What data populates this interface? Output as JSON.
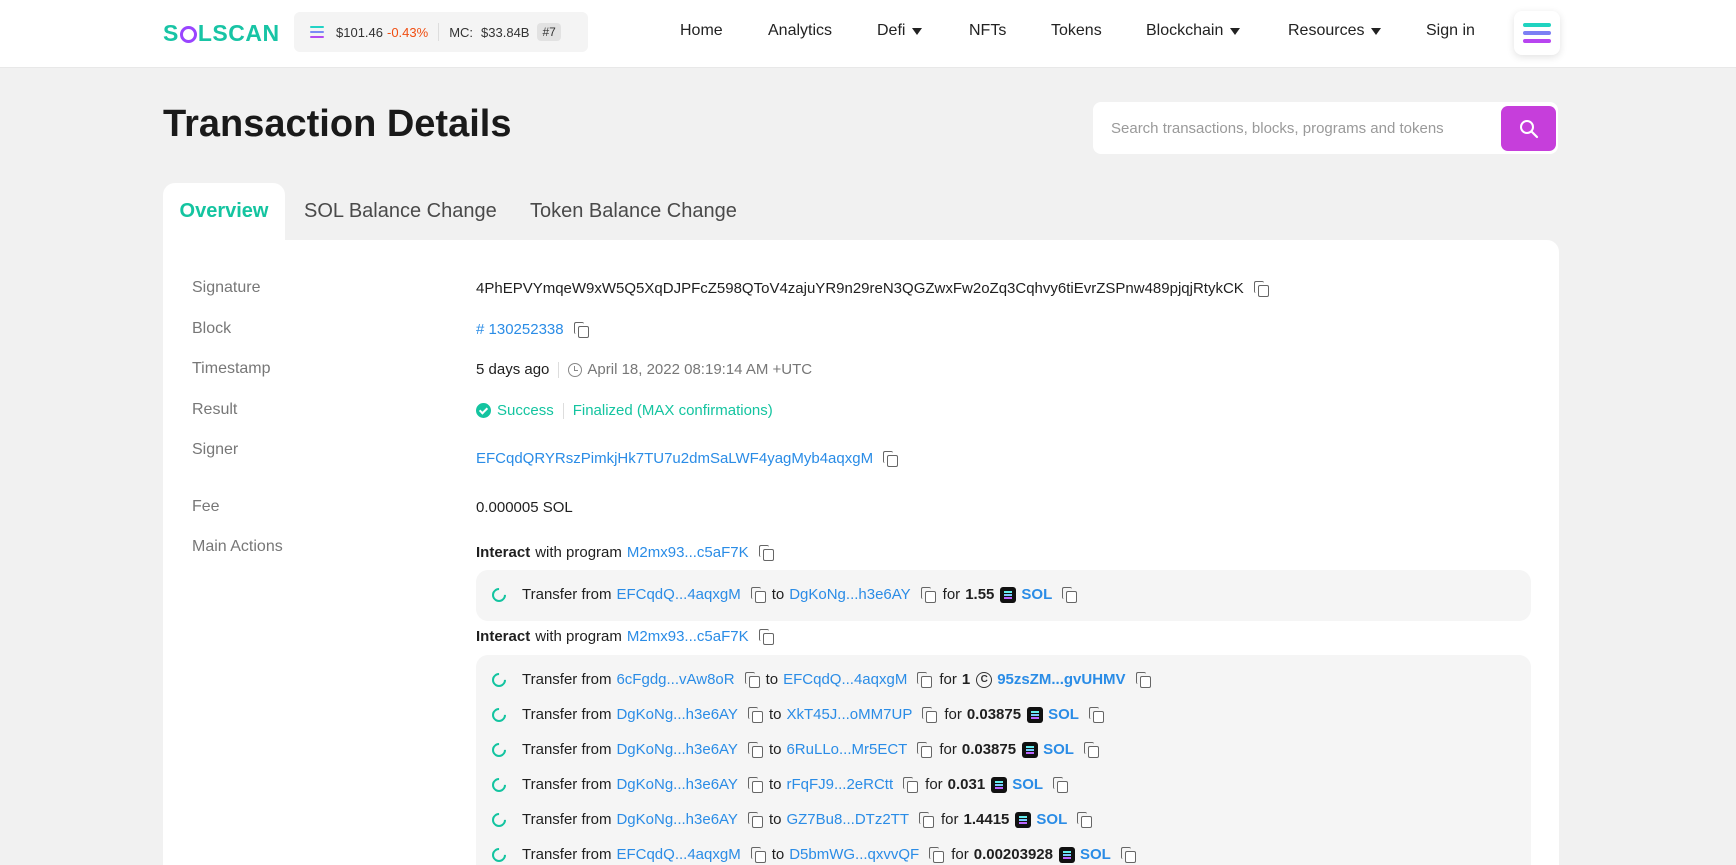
{
  "header": {
    "logo": {
      "pre": "S",
      "post": "LSCAN"
    },
    "price": "$101.46",
    "change": "-0.43%",
    "mc_label": "MC:",
    "mc_value": "$33.84B",
    "rank": "#7",
    "nav": {
      "home": "Home",
      "analytics": "Analytics",
      "defi": "Defi",
      "nfts": "NFTs",
      "tokens": "Tokens",
      "blockchain": "Blockchain",
      "resources": "Resources",
      "signin": "Sign in"
    },
    "colors": {
      "accent": "#14c4a0",
      "brand_purple": "#9945ff",
      "search_button": "#c63edb",
      "negative": "#f04e12",
      "link": "#2a8ce6"
    }
  },
  "page": {
    "title": "Transaction Details",
    "search_placeholder": "Search transactions, blocks, programs and tokens"
  },
  "tabs": {
    "overview": "Overview",
    "sol_balance": "SOL Balance Change",
    "token_balance": "Token Balance Change"
  },
  "details": {
    "signature_label": "Signature",
    "signature": "4PhEPVYmqeW9xW5Q5XqDJPFcZ598QToV4zajuYR9n29reN3QGZwxFw2oZq3Cqhvy6tiEvrZSPnw489pjqjRtykCK",
    "block_label": "Block",
    "block": "# 130252338",
    "timestamp_label": "Timestamp",
    "time_ago": "5 days ago",
    "time_full": "April 18, 2022 08:19:14 AM +UTC",
    "result_label": "Result",
    "result": "Success",
    "finalized": "Finalized (MAX confirmations)",
    "signer_label": "Signer",
    "signer": "EFCqdQRYRszPimkjHk7TU7u2dmSaLWF4yagMyb4aqxgM",
    "fee_label": "Fee",
    "fee": "0.000005 SOL",
    "main_actions_label": "Main Actions"
  },
  "actions": {
    "interact_word": "Interact",
    "with_program": "with program",
    "transfer_from": "Transfer from",
    "to": "to",
    "for": "for",
    "group1": {
      "program": "M2mx93...c5aF7K",
      "transfers": [
        {
          "from": "EFCqdQ...4aqxgM",
          "to": "DgKoNg...h3e6AY",
          "amount": "1.55",
          "token": "SOL"
        }
      ]
    },
    "group2": {
      "program": "M2mx93...c5aF7K",
      "transfers": [
        {
          "from": "6cFgdg...vAw8oR",
          "to": "EFCqdQ...4aqxgM",
          "amount": "1",
          "token": "95zsZM...gvUHMV"
        },
        {
          "from": "DgKoNg...h3e6AY",
          "to": "XkT45J...oMM7UP",
          "amount": "0.03875",
          "token": "SOL"
        },
        {
          "from": "DgKoNg...h3e6AY",
          "to": "6RuLLo...Mr5ECT",
          "amount": "0.03875",
          "token": "SOL"
        },
        {
          "from": "DgKoNg...h3e6AY",
          "to": "rFqFJ9...2eRCtt",
          "amount": "0.031",
          "token": "SOL"
        },
        {
          "from": "DgKoNg...h3e6AY",
          "to": "GZ7Bu8...DTz2TT",
          "amount": "1.4415",
          "token": "SOL"
        },
        {
          "from": "EFCqdQ...4aqxgM",
          "to": "D5bmWG...qxvvQF",
          "amount": "0.00203928",
          "token": "SOL"
        }
      ]
    }
  }
}
